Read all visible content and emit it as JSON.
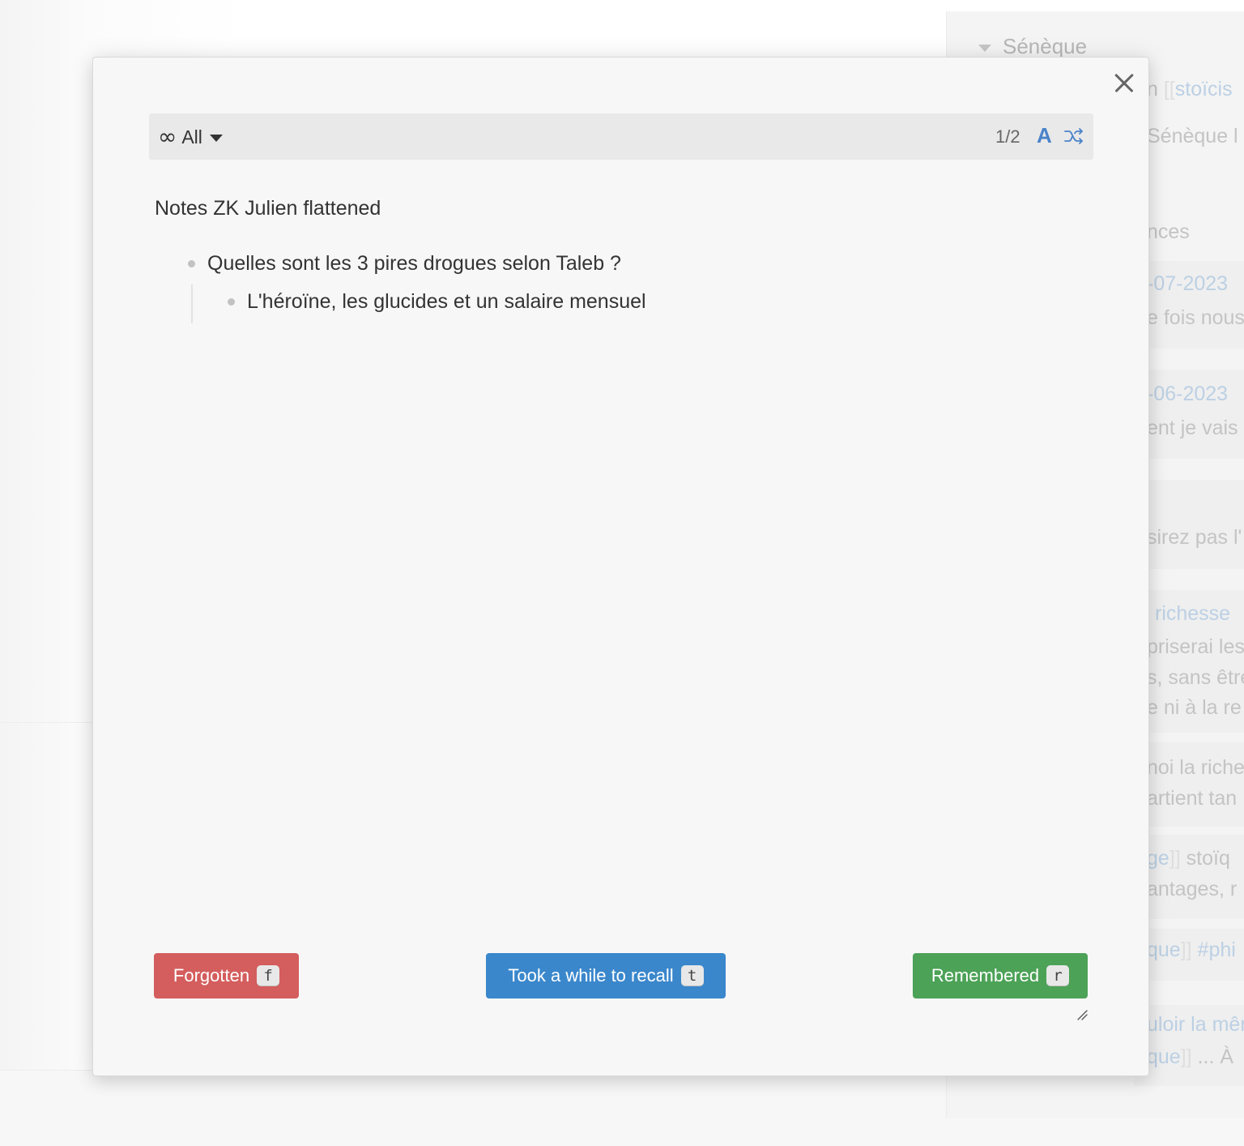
{
  "background": {
    "sidebar_header": "Sénèque",
    "fragments": [
      {
        "text": "n",
        "extra_dim": "[[",
        "extra_link": "stoïcis"
      },
      {
        "text": "Sénèque l"
      },
      {
        "text": "nces"
      },
      {
        "link": "-07-2023"
      },
      {
        "text": "e fois nous"
      },
      {
        "link": "-06-2023"
      },
      {
        "text": "ent je vais"
      },
      {
        "text": "sirez pas l'"
      },
      {
        "link": "richesse"
      },
      {
        "text": "priserai les"
      },
      {
        "text": "s, sans être"
      },
      {
        "text": "e ni à la re"
      },
      {
        "text": "noi la riche"
      },
      {
        "text": "artient tan"
      },
      {
        "link": "ge",
        "extra_dim": "]]",
        "extra_text": " stoïq"
      },
      {
        "text": "antages, r"
      },
      {
        "link": "que",
        "extra_dim": "]]",
        "extra_link": " #phi"
      },
      {
        "link": "uloir la mêr"
      },
      {
        "link": "que",
        "extra_dim": "]]",
        "extra_text": " ... À"
      }
    ]
  },
  "modal": {
    "filter_label": "All",
    "counter": "1/2",
    "font_toggle": "A",
    "card_title": "Notes ZK Julien flattened",
    "question": "Quelles sont les 3 pires drogues selon Taleb ?",
    "answer": "L'héroïne, les glucides et un salaire mensuel",
    "buttons": {
      "forgotten": {
        "label": "Forgotten",
        "key": "f"
      },
      "recall": {
        "label": "Took a while to recall",
        "key": "t"
      },
      "remembered": {
        "label": "Remembered",
        "key": "r"
      }
    }
  },
  "colors": {
    "forgotten": "#d45d5d",
    "recall": "#3a87cc",
    "remembered": "#4ca257",
    "accent_icon": "#4a83c9"
  },
  "icons": {
    "close": "close-icon",
    "filter": "infinity-icon",
    "dropdown": "caret-down-icon",
    "font": "font-icon",
    "shuffle": "shuffle-icon",
    "resize": "resize-handle-icon"
  }
}
